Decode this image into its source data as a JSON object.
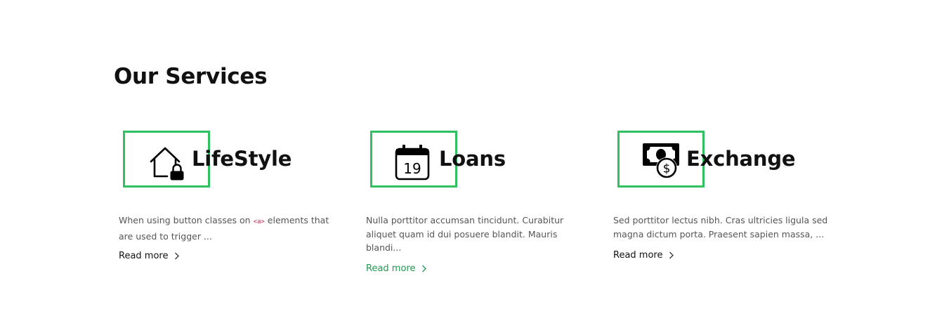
{
  "section": {
    "title": "Our Services"
  },
  "services": [
    {
      "title": "LifeStyle",
      "icon": "house-lock-icon",
      "desc_before": "When using button classes on ",
      "desc_code": "<a>",
      "desc_after": " elements that are used to trigger ...",
      "read_more": "Read more"
    },
    {
      "title": "Loans",
      "icon": "calendar-icon",
      "calendar_day": "19",
      "desc": "Nulla porttitor accumsan tincidunt. Curabitur aliquet quam id dui posuere blandit. Mauris blandi...",
      "read_more": "Read more"
    },
    {
      "title": "Exchange",
      "icon": "money-exchange-icon",
      "desc": "Sed porttitor lectus nibh. Cras ultricies ligula sed magna dictum porta. Praesent sapien massa, ...",
      "read_more": "Read more"
    }
  ],
  "colors": {
    "accent": "#2fc05f",
    "link_hover": "#1e9a4e",
    "text": "#111111",
    "muted": "#555555",
    "code": "#c7254e"
  }
}
